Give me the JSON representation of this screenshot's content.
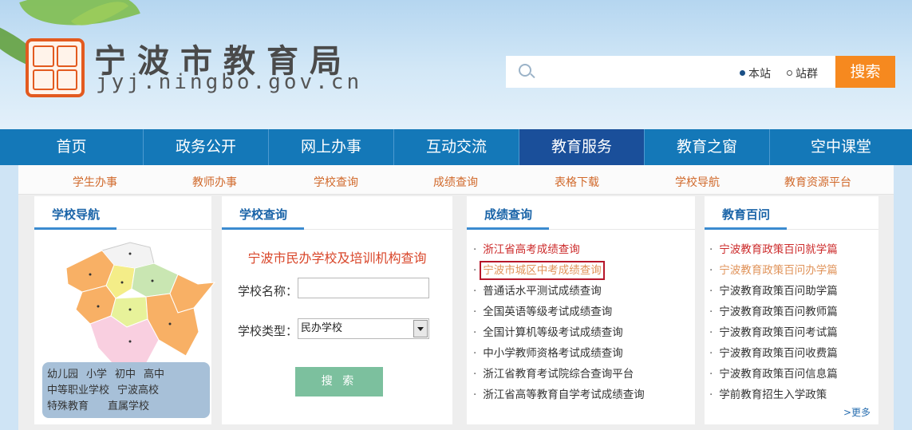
{
  "header": {
    "site_title": "宁波市教育局",
    "site_domain": "jyj.ningbo.gov.cn",
    "search": {
      "placeholder": "",
      "scope_local": "本站",
      "scope_group": "站群",
      "button": "搜索"
    },
    "colors": {
      "nav": "#1478b8",
      "nav_active": "#1a4f9a",
      "search_button": "#f6891f"
    }
  },
  "nav": {
    "items": [
      "首页",
      "政务公开",
      "网上办事",
      "互动交流",
      "教育服务",
      "教育之窗",
      "空中课堂"
    ],
    "active_index": 4
  },
  "subnav": {
    "items": [
      "学生办事",
      "教师办事",
      "学校查询",
      "成绩查询",
      "表格下载",
      "学校导航",
      "教育资源平台"
    ]
  },
  "school_nav": {
    "title": "学校导航",
    "links_row1": [
      "幼儿园",
      "小学",
      "初中",
      "高中"
    ],
    "links_row2": [
      "中等职业学校",
      "宁波高校"
    ],
    "links_row3": [
      "特殊教育",
      "直属学校"
    ]
  },
  "school_query": {
    "title": "学校查询",
    "heading": "宁波市民办学校及培训机构查询",
    "name_label": "学校名称：",
    "name_value": "",
    "type_label": "学校类型：",
    "type_value": "民办学校",
    "button": "搜 索"
  },
  "scores": {
    "title": "成绩查询",
    "items": [
      "浙江省高考成绩查询",
      "宁波市城区中考成绩查询",
      "普通话水平测试成绩查询",
      "全国英语等级考试成绩查询",
      "全国计算机等级考试成绩查询",
      "中小学教师资格考试成绩查询",
      "浙江省教育考试院综合查询平台",
      "浙江省高等教育自学考试成绩查询"
    ]
  },
  "faq": {
    "title": "教育百问",
    "items": [
      "宁波教育政策百问就学篇",
      "宁波教育政策百问办学篇",
      "宁波教育政策百问助学篇",
      "宁波教育政策百问教师篇",
      "宁波教育政策百问考试篇",
      "宁波教育政策百问收费篇",
      "宁波教育政策百问信息篇",
      "学前教育招生入学政策"
    ],
    "more": ">更多"
  }
}
